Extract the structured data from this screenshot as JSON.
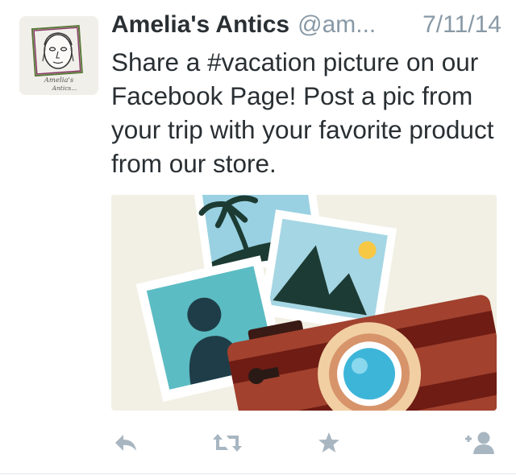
{
  "tweet": {
    "display_name": "Amelia's Antics",
    "handle": "@am...",
    "date": "7/11/14",
    "text": "Share a #vacation picture on our Facebook Page! Post a pic from your trip with your favorite product from our store.",
    "avatar_caption_line1": "Amelia's",
    "avatar_caption_line2": "Antics..."
  },
  "media": {
    "icon": "photos-and-camera-illustration"
  },
  "actions": [
    {
      "name": "reply-icon"
    },
    {
      "name": "retweet-icon"
    },
    {
      "name": "favorite-icon"
    },
    {
      "name": "follow-icon"
    }
  ],
  "colors": {
    "text": "#292f33",
    "muted": "#8899a6",
    "action_icon": "#a8b6c1",
    "media_bg": "#f2f0e4",
    "camera_body": "#a1412e",
    "camera_band": "#6e1c14",
    "lens": "#3db5d8",
    "photo_teal": "#5cbcc3",
    "photo_sky": "#99d1e2"
  }
}
